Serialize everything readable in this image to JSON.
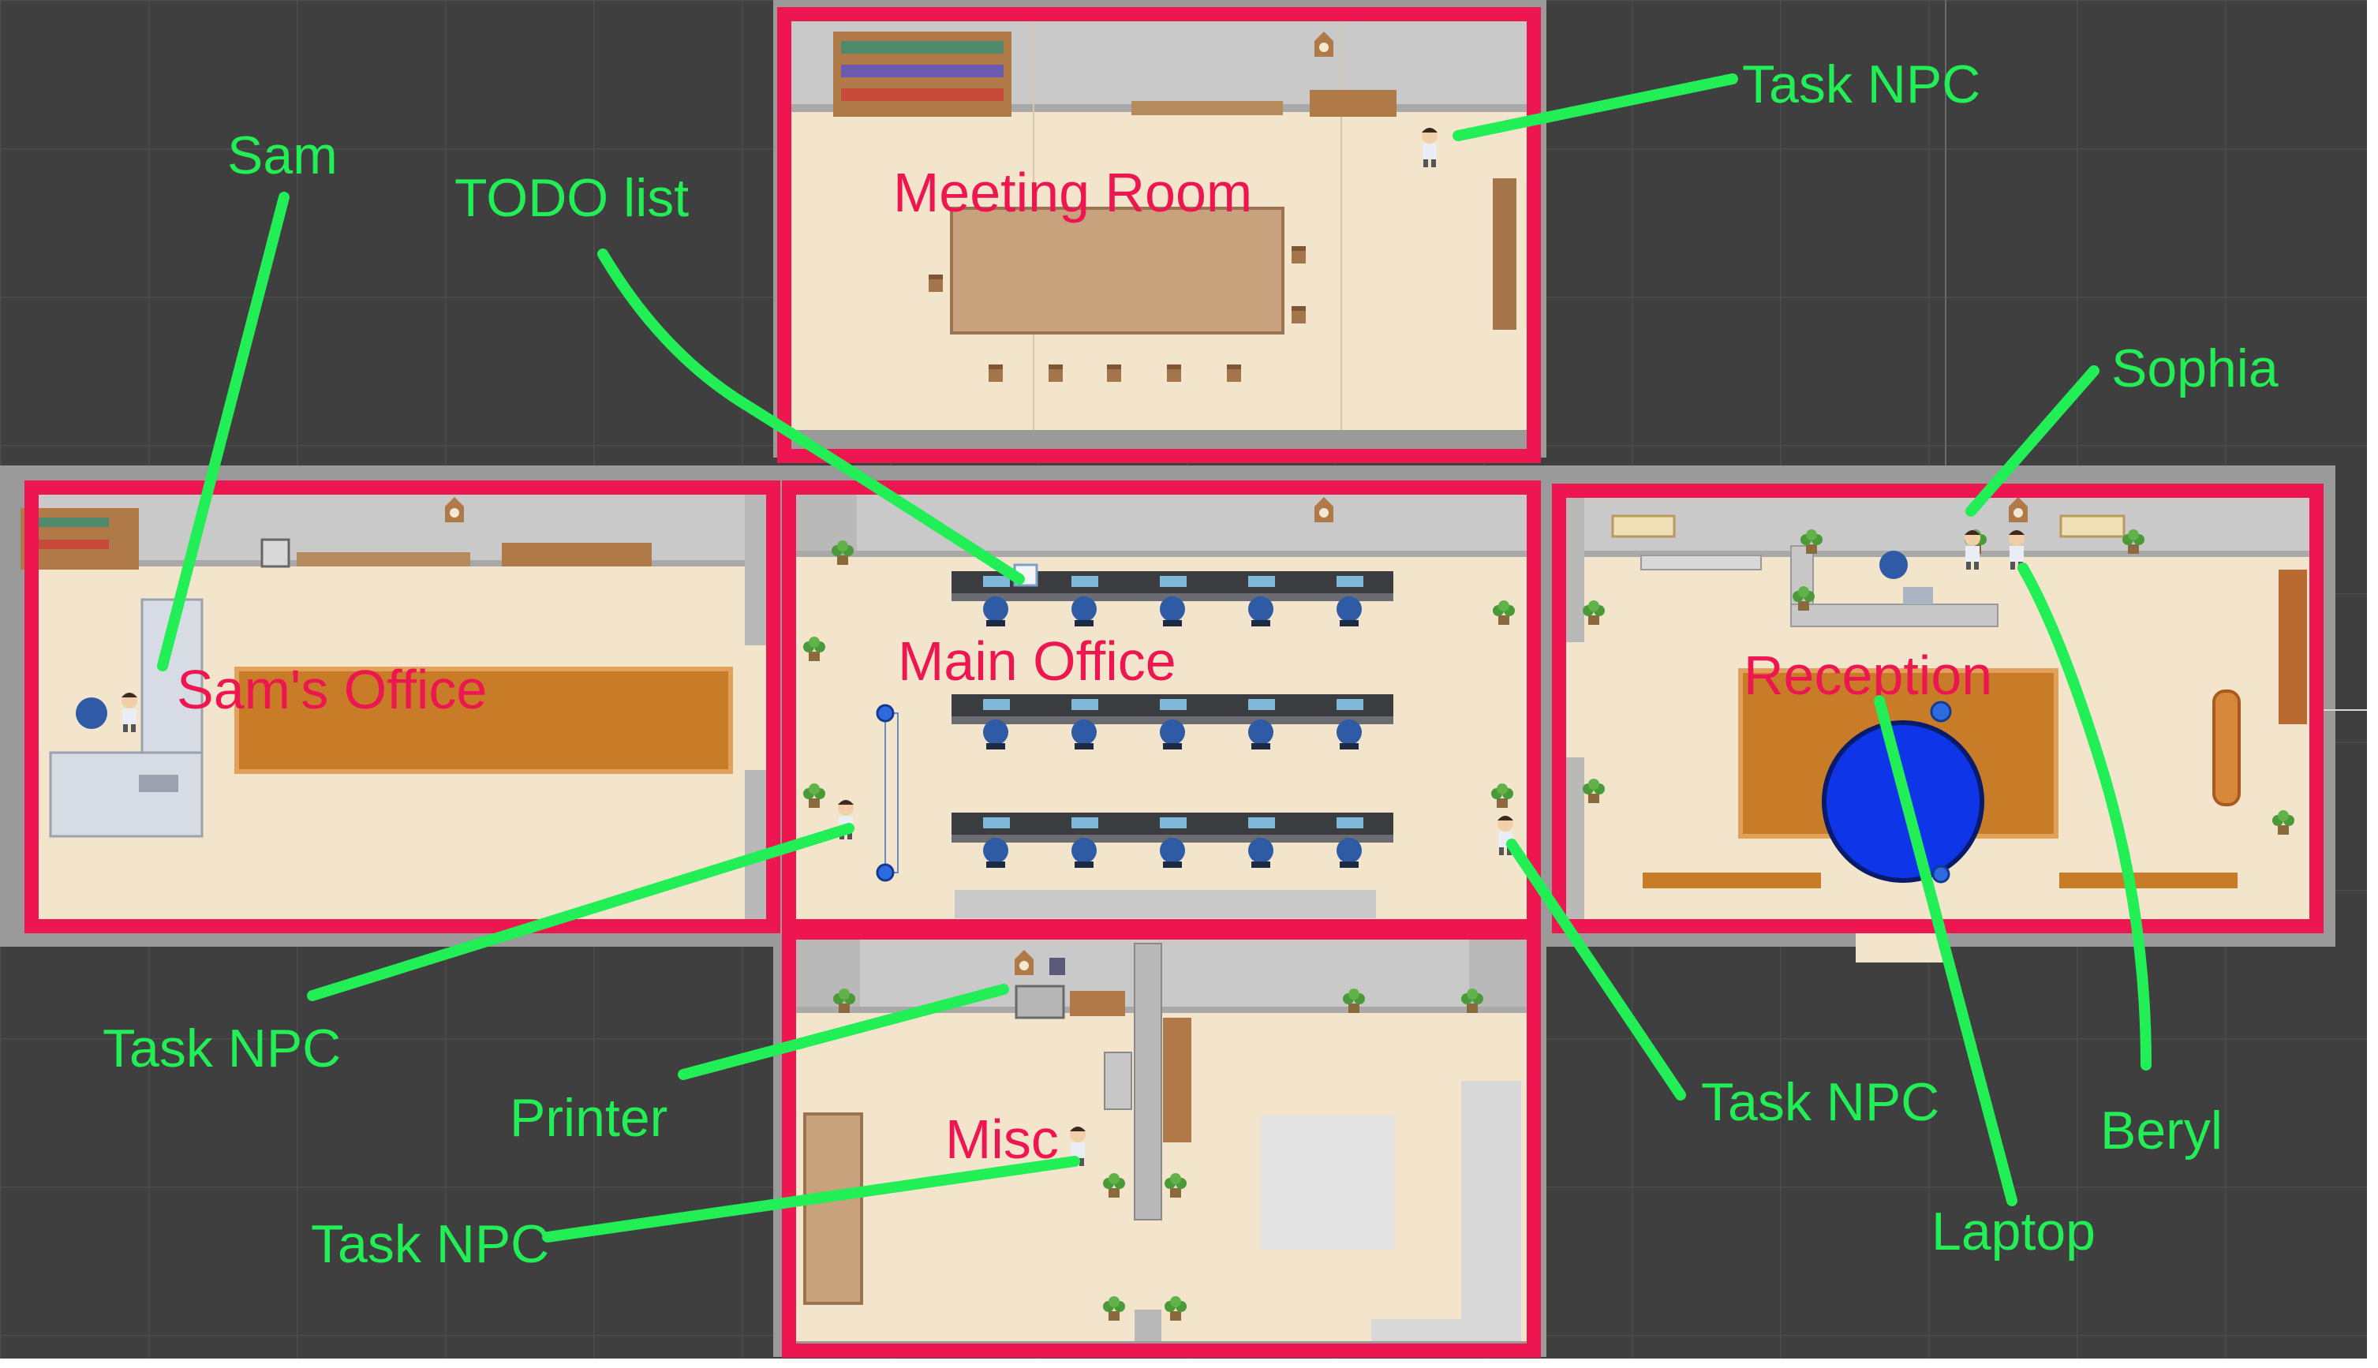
{
  "colors": {
    "background": "#3f3f3f",
    "grid_line": "#4c4c4c",
    "floor": "#f3e4cc",
    "wall": "#c9c9c9",
    "room_outline": "#ee1650",
    "annotation": "#22ee55",
    "wood": "#c89a6c",
    "rug": "#c87c28",
    "desk_dark": "#3a3c40",
    "chair_blue": "#2e5aa6",
    "marker_blue": "#1533d8"
  },
  "rooms": [
    {
      "id": "meeting-room",
      "label": "Meeting Room"
    },
    {
      "id": "sams-office",
      "label": "Sam's Office"
    },
    {
      "id": "main-office",
      "label": "Main Office"
    },
    {
      "id": "reception",
      "label": "Reception"
    },
    {
      "id": "misc",
      "label": "Misc"
    }
  ],
  "annotations": [
    {
      "id": "sam",
      "label": "Sam"
    },
    {
      "id": "todo-list",
      "label": "TODO list"
    },
    {
      "id": "task-npc-meeting",
      "label": "Task NPC"
    },
    {
      "id": "sophia",
      "label": "Sophia"
    },
    {
      "id": "task-npc-main-left",
      "label": "Task NPC"
    },
    {
      "id": "printer",
      "label": "Printer"
    },
    {
      "id": "task-npc-misc",
      "label": "Task NPC"
    },
    {
      "id": "task-npc-main-right",
      "label": "Task NPC"
    },
    {
      "id": "laptop",
      "label": "Laptop"
    },
    {
      "id": "beryl",
      "label": "Beryl"
    }
  ]
}
